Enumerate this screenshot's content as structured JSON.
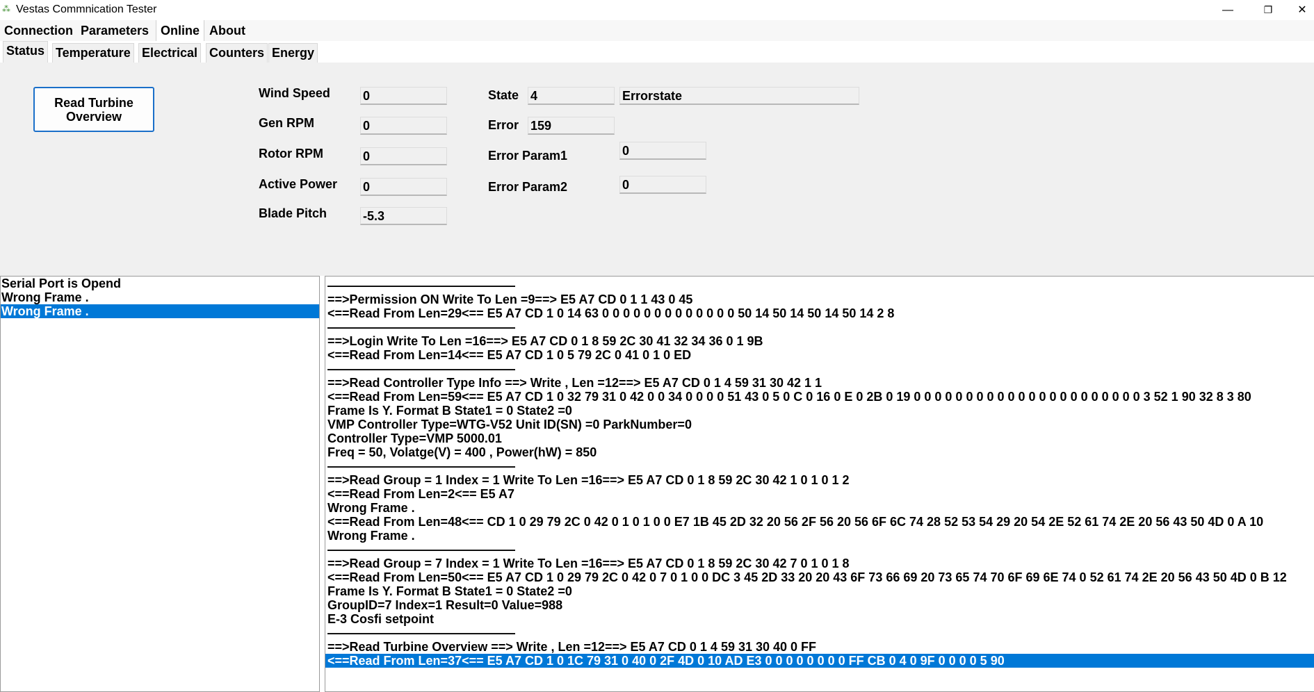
{
  "window": {
    "title": "Vestas Commnication Tester",
    "icon": "turbine-app-icon",
    "controls": {
      "minimize": "—",
      "maximize": "❐",
      "close": "✕"
    }
  },
  "menu": [
    "Connection",
    "Parameters",
    "Online",
    "About"
  ],
  "tabs": [
    "Status",
    "Temperature",
    "Electrical",
    "Counters",
    "Energy"
  ],
  "status": {
    "read_button": "Read Turbine Overview",
    "wind_speed": {
      "label": "Wind Speed",
      "value": "0"
    },
    "gen_rpm": {
      "label": "Gen RPM",
      "value": "0"
    },
    "rotor_rpm": {
      "label": "Rotor RPM",
      "value": "0"
    },
    "active_power": {
      "label": "Active Power",
      "value": "0"
    },
    "blade_pitch": {
      "label": "Blade Pitch",
      "value": "-5.3"
    },
    "state": {
      "label": "State",
      "value": "4",
      "text": "Errorstate"
    },
    "error": {
      "label": "Error",
      "value": "159"
    },
    "error_param1": {
      "label": "Error Param1",
      "value": "0"
    },
    "error_param2": {
      "label": "Error Param2",
      "value": "0"
    }
  },
  "events": [
    "Serial Port is Opend",
    "Wrong Frame .",
    "Wrong Frame ."
  ],
  "log": [
    "———————————————",
    "==>Permission ON Write To Len =9==> E5 A7 CD 0 1 1 43 0 45",
    "<==Read From Len=29<== E5 A7 CD 1 0 14 63 0 0 0 0 0 0 0 0 0 0 0 0 0 50 14 50 14 50 14 50 14 2 8",
    "———————————————",
    "==>Login Write To Len =16==> E5 A7 CD 0 1 8 59 2C 30 41 32 34 36 0 1 9B",
    "<==Read From Len=14<== E5 A7 CD 1 0 5 79 2C 0 41 0 1 0 ED",
    "———————————————",
    "==>Read Controller Type Info ==> Write , Len =12==> E5 A7 CD 0 1 4 59 31 30 42 1 1",
    "<==Read From Len=59<== E5 A7 CD 1 0 32 79 31 0 42 0 0 34 0 0 0 0 51 43 0 5 0 C 0 16 0 E 0 2B 0 19 0 0 0 0 0 0 0 0 0 0 0 0 0 0 0 0 0 0 0 0 0 0 3 52 1 90 32 8 3 80",
    "Frame Is Y. Format B State1 = 0 State2 =0",
    "VMP Controller Type=WTG-V52 Unit ID(SN) =0 ParkNumber=0",
    "Controller Type=VMP 5000.01",
    "Freq = 50, Volatge(V) = 400 , Power(hW) = 850",
    "———————————————",
    "==>Read Group = 1 Index = 1 Write To Len =16==> E5 A7 CD 0 1 8 59 2C 30 42 1 0 1 0 1 2",
    "<==Read From Len=2<== E5 A7",
    "Wrong Frame .",
    "<==Read From Len=48<== CD 1 0 29 79 2C 0 42 0 1 0 1 0 0 E7 1B 45 2D 32 20 56 2F 56 20 56 6F 6C 74 28 52 53 54 29 20 54 2E 52 61 74 2E 20 56 43 50 4D 0 A 10",
    "Wrong Frame .",
    "———————————————",
    "==>Read Group = 7 Index = 1 Write To Len =16==> E5 A7 CD 0 1 8 59 2C 30 42 7 0 1 0 1 8",
    "<==Read From Len=50<== E5 A7 CD 1 0 29 79 2C 0 42 0 7 0 1 0 0 DC 3 45 2D 33 20 20 43 6F 73 66 69 20 73 65 74 70 6F 69 6E 74 0 52 61 74 2E 20 56 43 50 4D 0 B 12",
    "Frame Is Y. Format B State1 = 0 State2 =0",
    "GroupID=7 Index=1 Result=0 Value=988",
    "E-3  Cosfi setpoint",
    "———————————————",
    "==>Read Turbine Overview ==> Write , Len =12==> E5 A7 CD 0 1 4 59 31 30 40 0 FF",
    "<==Read From Len=37<== E5 A7 CD 1 0 1C 79 31 0 40 0 2F 4D 0 10 AD E3 0 0 0 0 0 0 0 0 FF CB 0 4 0 9F 0 0 0 0 5 90"
  ]
}
